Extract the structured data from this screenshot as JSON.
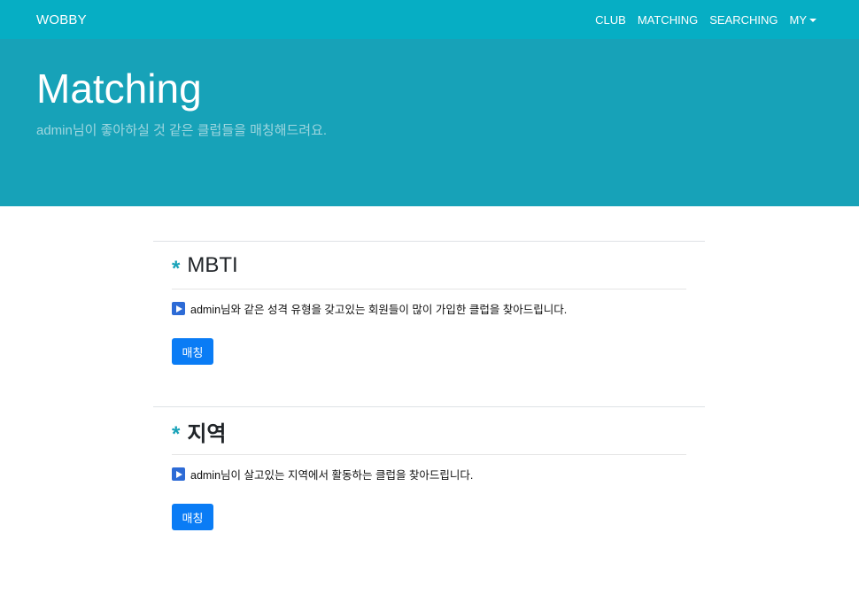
{
  "navbar": {
    "brand": "WOBBY",
    "links": [
      "CLUB",
      "MATCHING",
      "SEARCHING",
      "MY"
    ]
  },
  "hero": {
    "title": "Matching",
    "subtitle": "admin님이 좋아하실 것 같은 클럽들을 매칭해드려요."
  },
  "sections": [
    {
      "title": "MBTI",
      "description": "admin님와 같은 성격 유형을 갖고있는 회원들이 많이 가입한 클럽을 찾아드립니다.",
      "button": "매칭"
    },
    {
      "title": "지역",
      "description": "admin님이 살고있는 지역에서 활동하는 클럽을 찾아드립니다.",
      "button": "매칭"
    }
  ],
  "colors": {
    "navbar": "#06aec4",
    "hero": "#17a2b8",
    "button": "#0a7cf5"
  },
  "icons": {
    "section_marker": "asterisk-icon",
    "description_marker": "play-icon",
    "dropdown": "caret-down-icon"
  }
}
